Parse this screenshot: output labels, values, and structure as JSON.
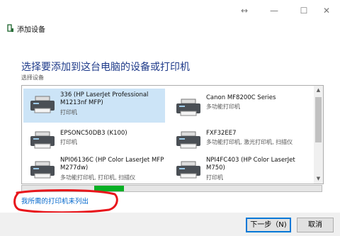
{
  "window": {
    "title": "添加设备",
    "controls": {
      "minimize": "—",
      "maximize": "☐",
      "close": "✕",
      "move": "↔"
    }
  },
  "main": {
    "heading": "选择要添加到这台电脑的设备或打印机",
    "subheading": "选择设备"
  },
  "devices": [
    {
      "name": "336 (HP LaserJet Professional M1213nf MFP)",
      "type": "打印机",
      "selected": true
    },
    {
      "name": "Canon MF8200C Series",
      "type": "多功能打印机",
      "selected": false
    },
    {
      "name": "EPSONC50DB3 (K100)",
      "type": "打印机",
      "selected": false
    },
    {
      "name": "FXF32EE7",
      "type": "多功能打印机, 激光打印机, 扫描仪",
      "selected": false
    },
    {
      "name": "NPI06136C (HP Color LaserJet MFP M277dw)",
      "type": "多功能打印机, 打印机, 扫描仪",
      "selected": false
    },
    {
      "name": "NPI4FC403 (HP Color LaserJet M750)",
      "type": "打印机",
      "selected": false
    }
  ],
  "search_progress": {
    "fill_start": 0.24,
    "fill_fraction": 0.1
  },
  "link_text": "我所需的打印机未列出",
  "footer": {
    "next_label": "下一步（N)",
    "cancel_label": "取消"
  },
  "colors": {
    "heading": "#1f3b8a",
    "selection": "#cce4f7",
    "progress": "#06b025",
    "link": "#0066cc",
    "marker": "#e8151b"
  },
  "icons": [
    "printer-icon",
    "add-device-app-icon",
    "scroll-up-arrow",
    "scroll-down-arrow"
  ]
}
